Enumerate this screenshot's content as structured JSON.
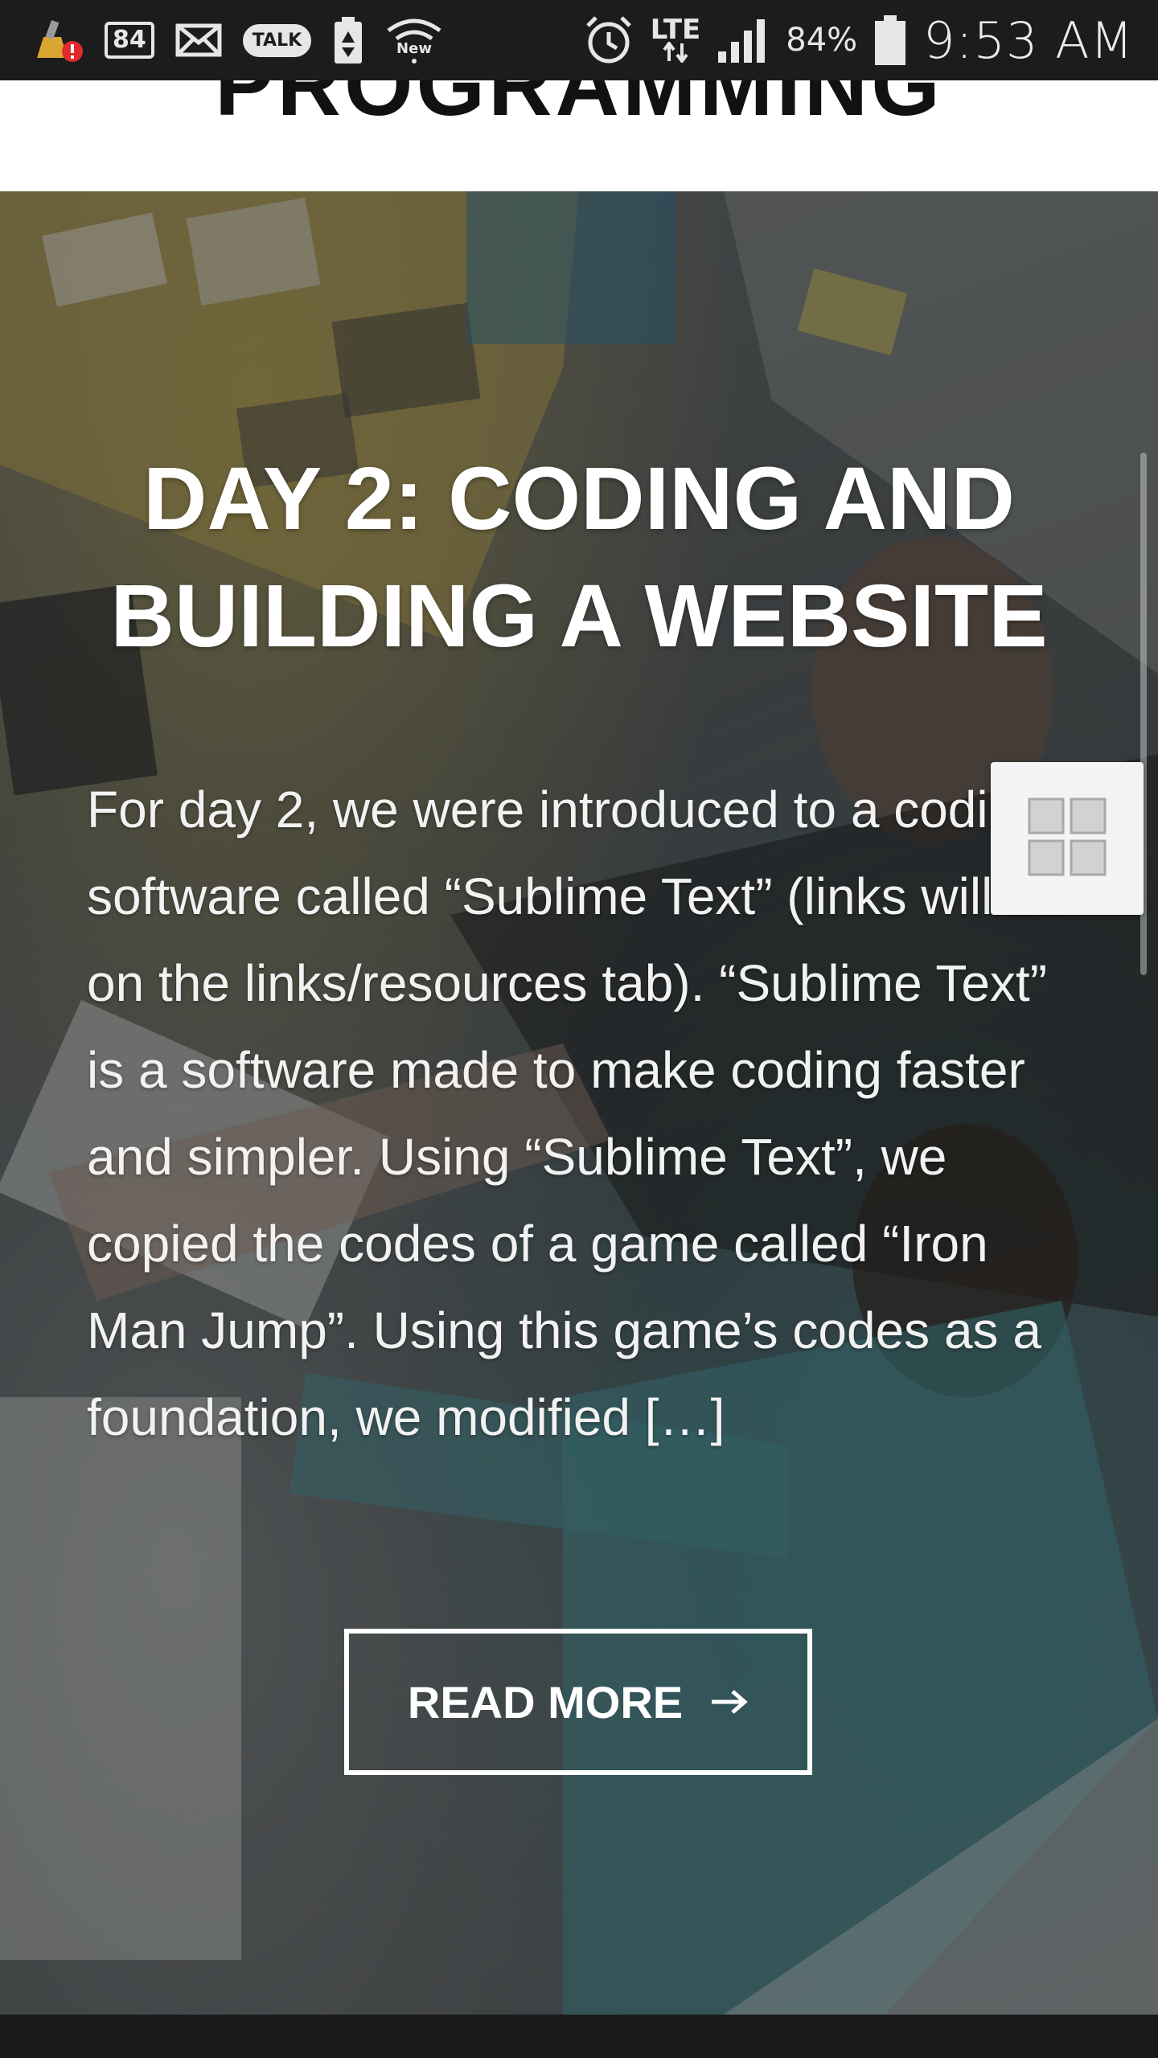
{
  "status_bar": {
    "notification_count": "84",
    "talk_label": "TALK",
    "wifi_label": "New",
    "network": "LTE",
    "battery": "84%",
    "time": "9:53 AM"
  },
  "header": {
    "title_fragment": "PROGRAMMING"
  },
  "post": {
    "title": "DAY 2: CODING AND BUILDING A WEBSITE",
    "excerpt": "For day 2, we were introduced to a coding software called “Sublime Text” (links will be on the links/resources tab). “Sublime Text” is a software made to make coding faster and simpler. Using “Sublime Text”, we copied the codes of a game called “Iron Man Jump”. Using this game’s codes as a foundation, we modified […]",
    "read_more_label": "READ MORE",
    "read_more_icon": "arrow-right-icon"
  },
  "widget": {
    "icon": "grid-icon"
  },
  "colors": {
    "status_bar_bg": "#1c1c1c",
    "header_bg": "#ffffff",
    "text_on_image": "#ffffff",
    "widget_bg": "#f4f4f4"
  }
}
